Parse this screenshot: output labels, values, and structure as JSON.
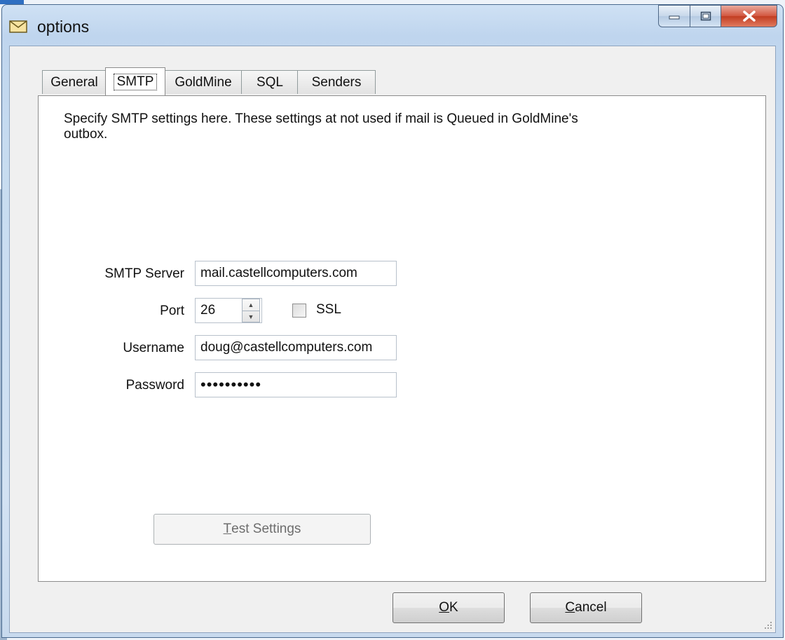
{
  "window": {
    "title": "options",
    "icon": "envelope-icon"
  },
  "caption_buttons": {
    "minimize": "minimize-icon",
    "maximize": "maximize-icon",
    "close": "close-icon"
  },
  "tabs": [
    {
      "label": "General",
      "active": false
    },
    {
      "label": "SMTP",
      "active": true
    },
    {
      "label": "GoldMine",
      "active": false
    },
    {
      "label": "SQL",
      "active": false
    },
    {
      "label": "Senders",
      "active": false
    }
  ],
  "smtp": {
    "description": "Specify SMTP settings here.  These settings at not used if mail is Queued in GoldMine's outbox.",
    "server": {
      "label": "SMTP Server",
      "value": "mail.castellcomputers.com"
    },
    "port": {
      "label": "Port",
      "value": "26"
    },
    "ssl": {
      "label": "SSL",
      "checked": false
    },
    "username": {
      "label": "Username",
      "value": "doug@castellcomputers.com"
    },
    "password": {
      "label": "Password",
      "value": "••••••••••"
    },
    "test_button": {
      "mnemonic": "T",
      "rest": "est Settings",
      "enabled": false
    }
  },
  "footer": {
    "ok_button": {
      "mnemonic": "O",
      "rest": "K"
    },
    "cancel_button": {
      "mnemonic": "C",
      "rest": "ancel"
    }
  },
  "colors": {
    "title_bar": "#c6dbf0",
    "close_button": "#c23d22",
    "panel": "#ffffff",
    "dialog": "#f0f0f0"
  }
}
